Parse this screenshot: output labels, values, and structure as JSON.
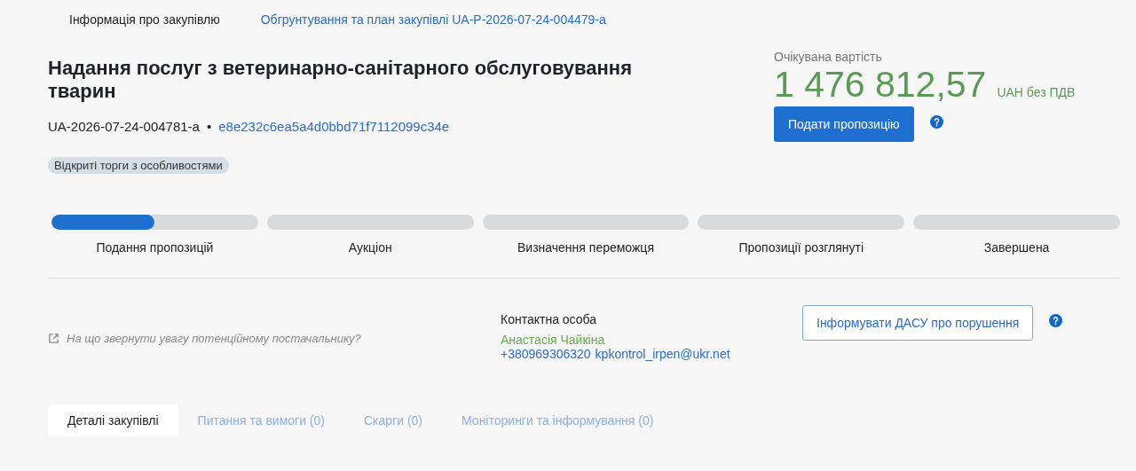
{
  "top_tabs": [
    {
      "label": "Інформація про закупівлю",
      "selected": true
    },
    {
      "label": "Обгрунтування та план закупівлі UA-P-2026-07-24-004479-a",
      "selected": false
    }
  ],
  "title": "Надання послуг з ветеринарно-санітарного обслуговування тварин",
  "tender_id": "UA-2026-07-24-004781-a",
  "separator": "•",
  "hash_link": "e8e232c6ea5a4d0bbd71f7112099c34e",
  "procedure_badge": "Відкриті торги з особливостями",
  "expected_value": {
    "label": "Очікувана вартість",
    "amount": "1 476 812,57",
    "currency": "UAH без ПДВ"
  },
  "submit_button": "Подати пропозицію",
  "stages": [
    {
      "label": "Подання пропозицій",
      "level": 0.5
    },
    {
      "label": "Аукціон"
    },
    {
      "label": "Визначення переможця"
    },
    {
      "label": "Пропозиції розглянуті"
    },
    {
      "label": "Завершена"
    }
  ],
  "supplier_hint": "На що звернути увагу потенційному постачальнику?",
  "contact": {
    "heading": "Контактна особа",
    "name": "Анастасія Чайкіна",
    "phone": "+380969306320",
    "email": "kpkontrol_irpen@ukr.net"
  },
  "report_button": "Інформувати ДАСУ про порушення",
  "bottom_tabs": [
    {
      "label": "Деталі закупівлі",
      "selected": true
    },
    {
      "label": "Питання та вимоги (0)",
      "selected": false
    },
    {
      "label": "Скарги (0)",
      "selected": false
    },
    {
      "label": "Моніторинги та інформування (0)",
      "selected": false
    }
  ]
}
